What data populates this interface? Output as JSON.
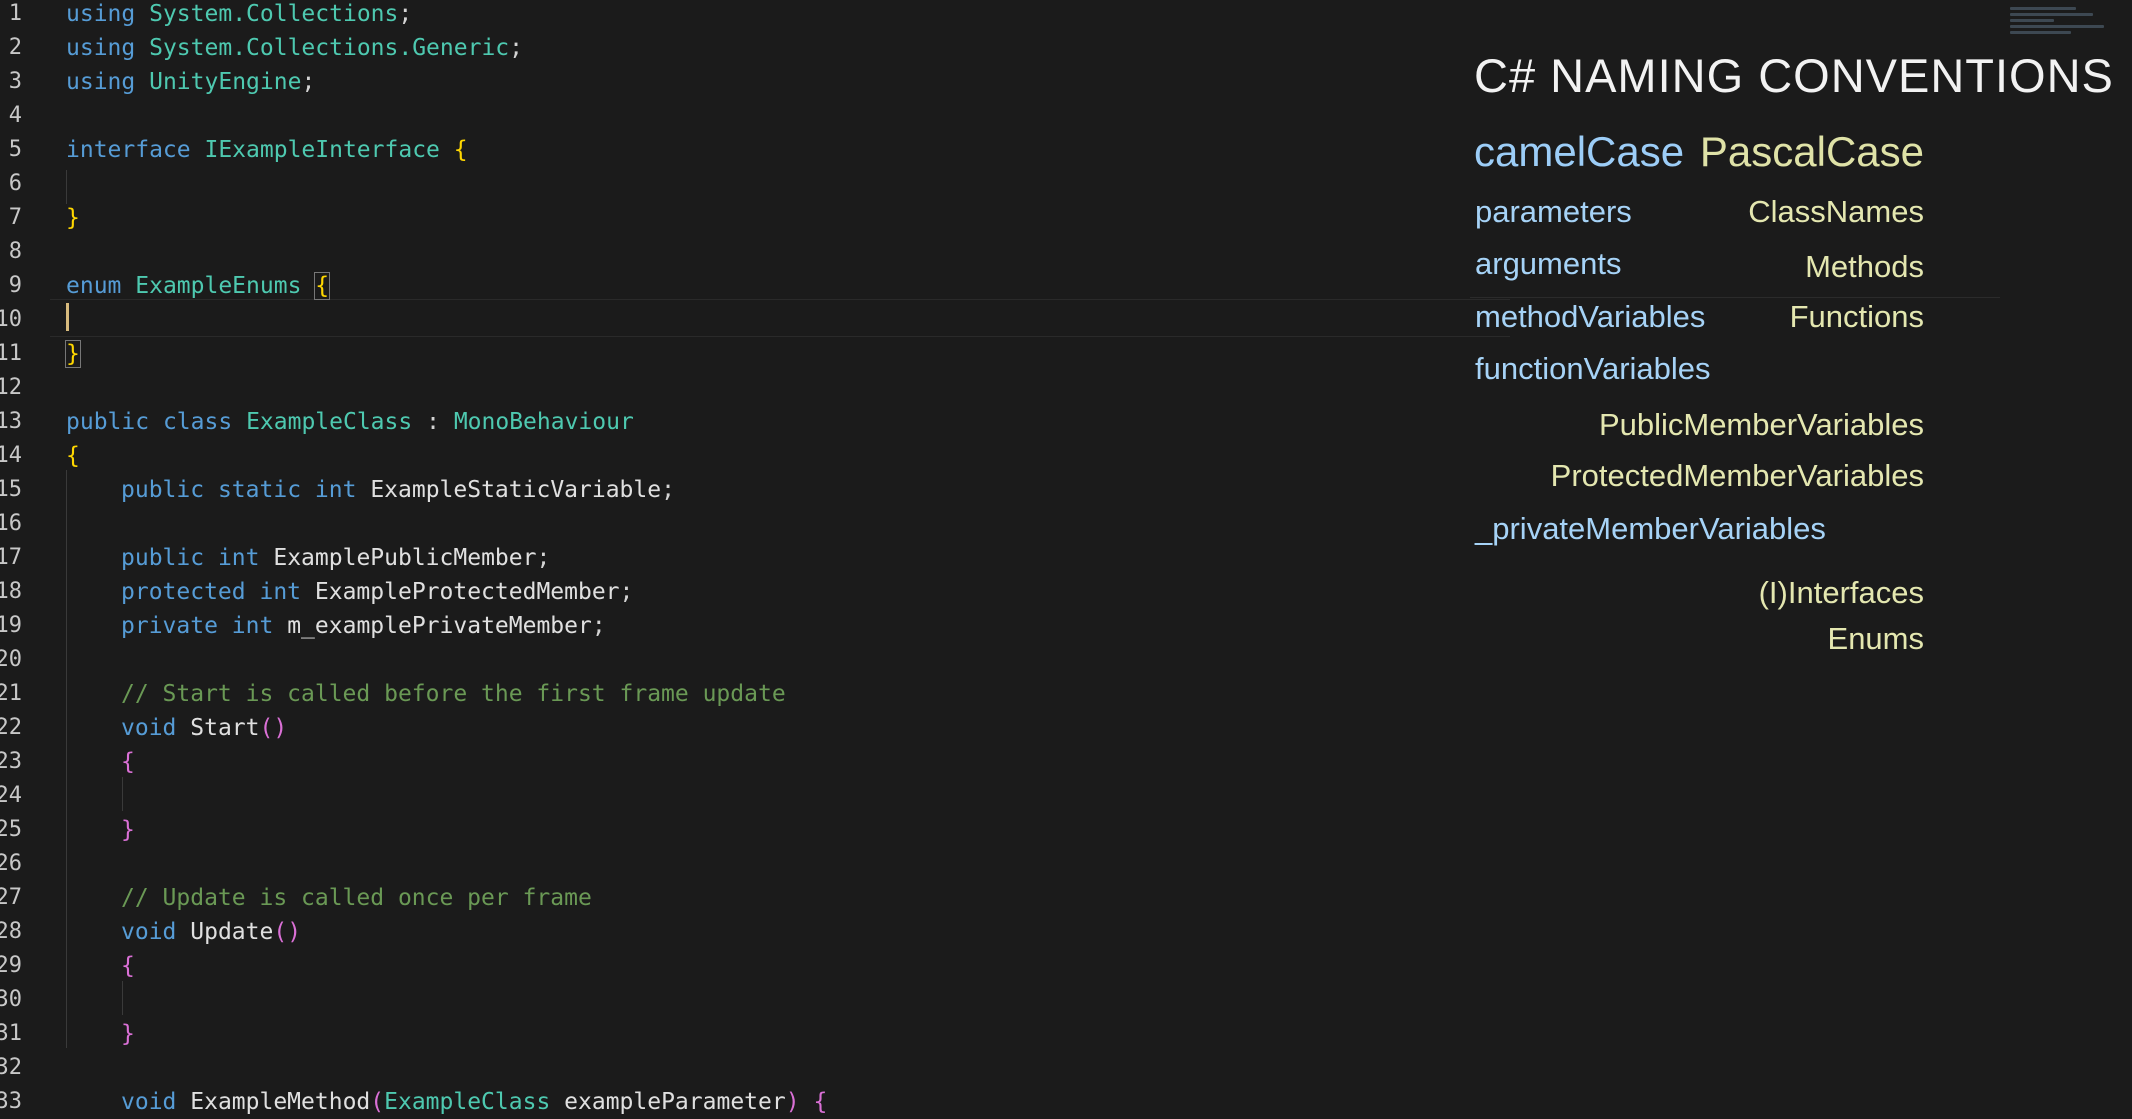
{
  "line_numbers": [
    "1",
    "2",
    "3",
    "4",
    "5",
    "6",
    "7",
    "8",
    "9",
    "10",
    "11",
    "12",
    "13",
    "14",
    "15",
    "16",
    "17",
    "18",
    "19",
    "20",
    "21",
    "22",
    "23",
    "24",
    "25",
    "26",
    "27",
    "28",
    "29",
    "30",
    "31",
    "32",
    "33"
  ],
  "code": {
    "l1": {
      "kw": "using",
      "ns": "System.Collections",
      "end": ";"
    },
    "l2": {
      "kw": "using",
      "ns": "System.Collections.Generic",
      "end": ";"
    },
    "l3": {
      "kw": "using",
      "ns": "UnityEngine",
      "end": ";"
    },
    "l5": {
      "kw": "interface",
      "name": "IExampleInterface",
      "brace": "{"
    },
    "l7": {
      "brace": "}"
    },
    "l9": {
      "kw": "enum",
      "name": "ExampleEnums",
      "brace": "{"
    },
    "l11": {
      "brace": "}"
    },
    "l13": {
      "kw1": "public",
      "kw2": "class",
      "name": "ExampleClass",
      "colon": ":",
      "base": "MonoBehaviour"
    },
    "l14": {
      "brace": "{"
    },
    "l15": {
      "kw1": "public",
      "kw2": "static",
      "kw3": "int",
      "name": "ExampleStaticVariable",
      "end": ";"
    },
    "l17": {
      "kw1": "public",
      "kw2": "int",
      "name": "ExamplePublicMember",
      "end": ";"
    },
    "l18": {
      "kw1": "protected",
      "kw2": "int",
      "name": "ExampleProtectedMember",
      "end": ";"
    },
    "l19": {
      "kw1": "private",
      "kw2": "int",
      "name": "m_examplePrivateMember",
      "end": ";"
    },
    "l21": {
      "comment": "// Start is called before the first frame update"
    },
    "l22": {
      "kw": "void",
      "name": "Start",
      "parens": "()"
    },
    "l23": {
      "brace": "{"
    },
    "l25": {
      "brace": "}"
    },
    "l27": {
      "comment": "// Update is called once per frame"
    },
    "l28": {
      "kw": "void",
      "name": "Update",
      "parens": "()"
    },
    "l29": {
      "brace": "{"
    },
    "l31": {
      "brace": "}"
    },
    "l33": {
      "kw": "void",
      "name": "ExampleMethod",
      "open": "(",
      "ptype": "ExampleClass",
      "pname": "exampleParameter",
      "close": ")",
      "brace": "{"
    }
  },
  "overlay": {
    "title": "C# NAMING CONVENTIONS",
    "camel_header": "camelCase",
    "pascal_header": "PascalCase",
    "camel_items": [
      "parameters",
      "arguments",
      "methodVariables",
      "functionVariables",
      "_privateMemberVariables"
    ],
    "pascal_items": [
      "ClassNames",
      "Methods",
      "Functions",
      "PublicMemberVariables",
      "ProtectedMemberVariables",
      "(I)Interfaces",
      "Enums"
    ]
  },
  "colors": {
    "background": "#1b1b1b",
    "keyword": "#569cd6",
    "type": "#4ec9b0",
    "comment": "#6a9955",
    "bracket_level1": "#ffd700",
    "bracket_level2": "#da70d6",
    "camel_text": "#a6d3f7",
    "pascal_text": "#e4e7b0"
  }
}
